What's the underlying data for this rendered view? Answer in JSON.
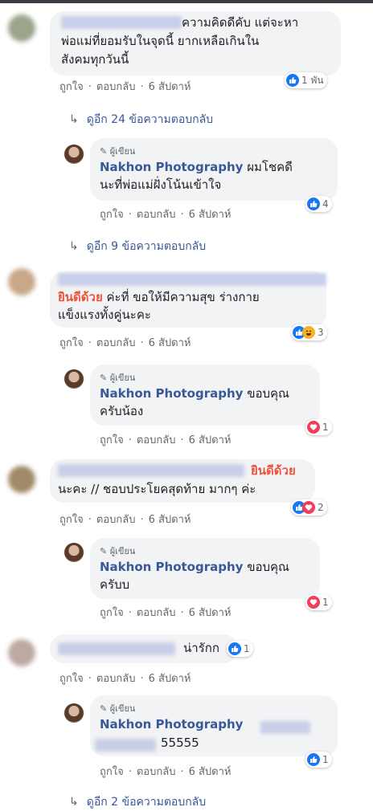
{
  "comments": [
    {
      "line1_suffix": "ความคิดดีคับ แต่จะหา",
      "line2": "พ่อแม่ที่ยอมรับในจุดนี้ ยากเหลือเกินใน",
      "line3": "สังคมทุกวันนี้",
      "actions": {
        "like": "ถูกใจ",
        "reply": "ตอบกลับ",
        "time": "6 สัปดาห์"
      },
      "reaction_count": "1 พัน",
      "more_replies": "ดูอีก 24 ข้อความตอบกลับ"
    },
    {
      "line1_prefix": "ยินดีด้วย",
      "line1_suffix": " ค่ะที่ ขอให้มีความสุข ร่างกาย",
      "line2": "แข็งแรงทั้งคู่นะคะ",
      "actions": {
        "like": "ถูกใจ",
        "reply": "ตอบกลับ",
        "time": "6 สัปดาห์"
      },
      "reaction_count": "3"
    },
    {
      "line1_suffix": "ยินดีด้วย",
      "line2": "นะคะ // ชอบประโยคสุดท้าย มากๆ ค่ะ",
      "actions": {
        "like": "ถูกใจ",
        "reply": "ตอบกลับ",
        "time": "6 สัปดาห์"
      },
      "reaction_count": "2"
    },
    {
      "line1_suffix": "น่ารักก",
      "actions": {
        "like": "ถูกใจ",
        "reply": "ตอบกลับ",
        "time": "6 สัปดาห์"
      },
      "reaction_count": "1"
    }
  ],
  "replies": [
    {
      "author_tag": "ผู้เขียน",
      "author_name": "Nakhon Photography",
      "line1_suffix": " ผมโชคดี",
      "line2": "นะที่พ่อแม่ฝั่งโน้นเข้าใจ",
      "actions": {
        "like": "ถูกใจ",
        "reply": "ตอบกลับ",
        "time": "6 สัปดาห์"
      },
      "reaction_count": "4",
      "more_replies": "ดูอีก 9 ข้อความตอบกลับ"
    },
    {
      "author_tag": "ผู้เขียน",
      "author_name": "Nakhon Photography",
      "line1_suffix": " ขอบคุณ",
      "line2": "ครับน้อง",
      "actions": {
        "like": "ถูกใจ",
        "reply": "ตอบกลับ",
        "time": "6 สัปดาห์"
      },
      "reaction_count": "1"
    },
    {
      "author_tag": "ผู้เขียน",
      "author_name": "Nakhon Photography",
      "line1_suffix": " ขอบคุณ",
      "line2": "ครับบ",
      "actions": {
        "like": "ถูกใจ",
        "reply": "ตอบกลับ",
        "time": "6 สัปดาห์"
      },
      "reaction_count": "1"
    },
    {
      "author_tag": "ผู้เขียน",
      "author_name": "Nakhon Photography",
      "line2_suffix": "55555",
      "actions": {
        "like": "ถูกใจ",
        "reply": "ตอบกลับ",
        "time": "6 สัปดาห์"
      },
      "reaction_count": "1"
    }
  ],
  "bottom_more": "ดูอีก 2 ข้อความตอบกลับ",
  "colors": {
    "like": "#1877f2",
    "love": "#f33e58",
    "link": "#385898",
    "bubble": "#f2f3f5"
  }
}
